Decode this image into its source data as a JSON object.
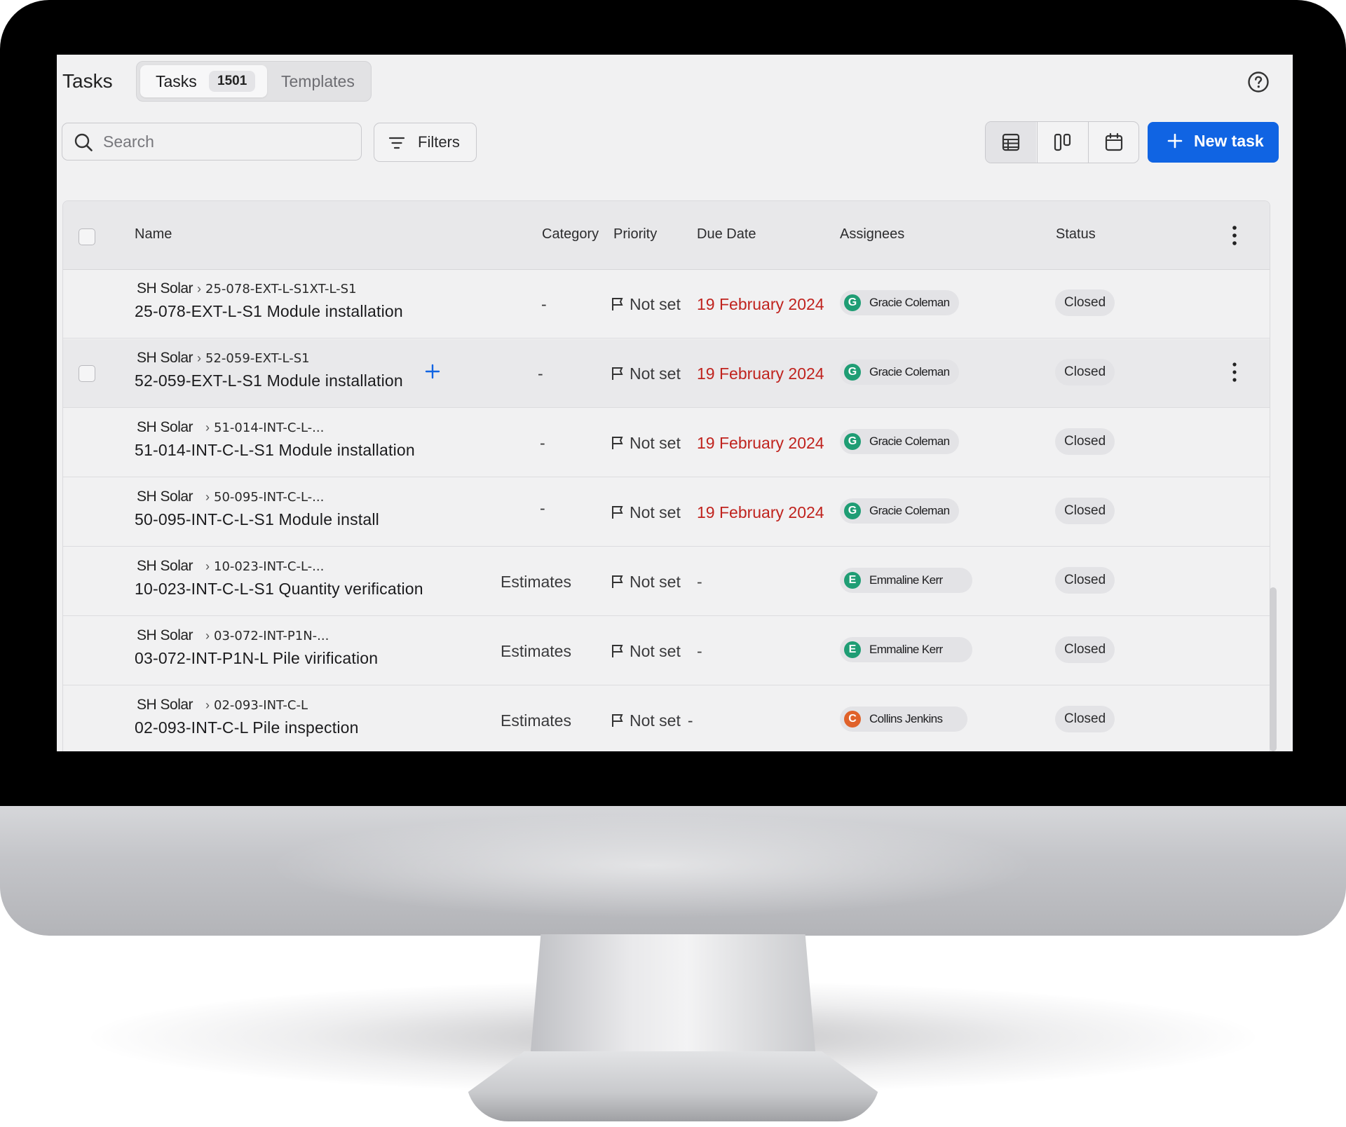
{
  "page": {
    "title": "Tasks"
  },
  "tabs": [
    {
      "label": "Tasks",
      "count": "1501",
      "active": true
    },
    {
      "label": "Templates",
      "active": false
    }
  ],
  "help_icon": "question-circle-icon",
  "search": {
    "placeholder": "Search",
    "value": ""
  },
  "filters": {
    "label": "Filters"
  },
  "view_modes": [
    {
      "name": "table",
      "icon": "table-icon",
      "active": true
    },
    {
      "name": "board",
      "icon": "columns-icon",
      "active": false
    },
    {
      "name": "calendar",
      "icon": "calendar-icon",
      "active": false
    }
  ],
  "new_task": {
    "label": "New task"
  },
  "table": {
    "columns": [
      "Name",
      "Category",
      "Priority",
      "Due Date",
      "Assignees",
      "Status"
    ],
    "rows": [
      {
        "project": "SH Solar",
        "path": "25-078-EXT-L-S1XT-L-S1",
        "name": "25-078-EXT-L-S1 Module installation",
        "category": "-",
        "priority": "Not set",
        "due": "19 February 2024",
        "assignee": "Gracie Coleman",
        "initial": "G",
        "status": "Closed"
      },
      {
        "project": "SH Solar",
        "path": "52-059-EXT-L-S1",
        "name": "52-059-EXT-L-S1 Module installation",
        "category": "-",
        "priority": "Not set",
        "due": "19 February 2024",
        "assignee": "Gracie Coleman",
        "initial": "G",
        "status": "Closed"
      },
      {
        "project": "SH Solar",
        "path": "51-014-INT-C-L-...",
        "name": "51-014-INT-C-L-S1 Module installation",
        "category": "-",
        "priority": "Not set",
        "due": "19 February 2024",
        "assignee": "Gracie Coleman",
        "initial": "G",
        "status": "Closed"
      },
      {
        "project": "SH Solar",
        "path": "50-095-INT-C-L-...",
        "name": "50-095-INT-C-L-S1 Module install",
        "category": "-",
        "priority": "Not set",
        "due": "19 February 2024",
        "assignee": "Gracie Coleman",
        "initial": "G",
        "status": "Closed"
      },
      {
        "project": "SH Solar",
        "path": "10-023-INT-C-L-...",
        "name": "10-023-INT-C-L-S1 Quantity verification",
        "category": "Estimates",
        "priority": "Not set",
        "due": "-",
        "assignee": "Emmaline Kerr",
        "initial": "E",
        "status": "Closed"
      },
      {
        "project": "SH Solar",
        "path": "03-072-INT-P1N-...",
        "name": "03-072-INT-P1N-L Pile virification",
        "category": "Estimates",
        "priority": "Not set",
        "due": "-",
        "assignee": "Emmaline Kerr",
        "initial": "E",
        "status": "Closed"
      },
      {
        "project": "SH Solar",
        "path": "02-093-INT-C-L",
        "name": "02-093-INT-C-L Pile inspection",
        "category": "Estimates",
        "priority": "Not set",
        "due": "-",
        "assignee": "Collins Jenkins",
        "initial": "C",
        "status": "Closed"
      }
    ]
  },
  "colors": {
    "accent": "#1064e3",
    "overdue": "#c0231e",
    "avatar_green": "#1f9d74",
    "avatar_orange": "#e0622a"
  }
}
